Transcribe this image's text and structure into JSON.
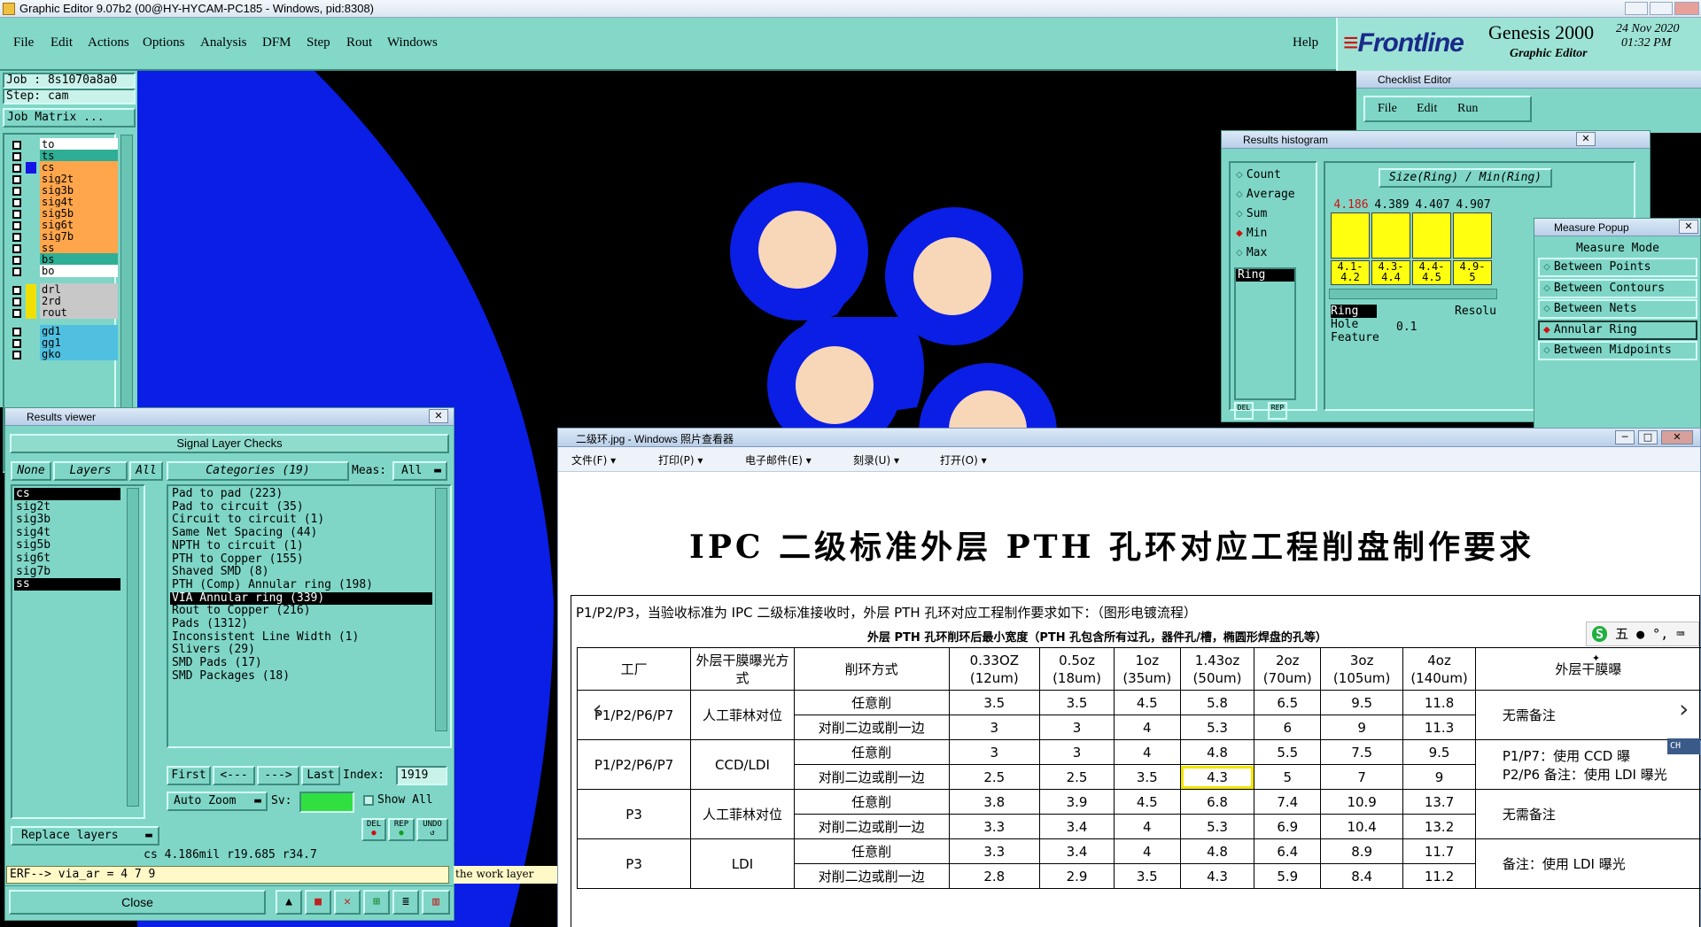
{
  "app": {
    "title": "Graphic Editor 9.07b2 (00@HY-HYCAM-PC185 - Windows, pid:8308)",
    "menu": [
      "File",
      "Edit",
      "Actions",
      "Options",
      "Analysis",
      "DFM",
      "Step",
      "Rout",
      "Windows"
    ],
    "help": "Help",
    "brand": "Frontline",
    "product": "Genesis 2000",
    "subtitle": "Graphic Editor",
    "date": "24 Nov 2020",
    "time": "01:32 PM"
  },
  "left": {
    "job": "Job : 8s1070a8a0",
    "step": "Step: cam",
    "matrix_btn": "Job Matrix ...",
    "layers": [
      {
        "name": "to",
        "bg": "#ffffff",
        "sel": false
      },
      {
        "name": "ts",
        "bg": "#2fae96",
        "sel": false
      },
      {
        "name": "cs",
        "bg": "#ffa64d",
        "sel": true
      },
      {
        "name": "sig2t",
        "bg": "#ffa64d",
        "sel": false
      },
      {
        "name": "sig3b",
        "bg": "#ffa64d",
        "sel": false
      },
      {
        "name": "sig4t",
        "bg": "#ffa64d",
        "sel": false
      },
      {
        "name": "sig5b",
        "bg": "#ffa64d",
        "sel": false
      },
      {
        "name": "sig6t",
        "bg": "#ffa64d",
        "sel": false
      },
      {
        "name": "sig7b",
        "bg": "#ffa64d",
        "sel": false
      },
      {
        "name": "ss",
        "bg": "#ffa64d",
        "sel": false
      },
      {
        "name": "bs",
        "bg": "#2fae96",
        "sel": false
      },
      {
        "name": "bo",
        "bg": "#ffffff",
        "sel": false
      },
      {
        "name": "drl",
        "bg": "#c8c8c8",
        "sel": false
      },
      {
        "name": "2rd",
        "bg": "#c8c8c8",
        "sel": false
      },
      {
        "name": "rout",
        "bg": "#c8c8c8",
        "sel": false
      },
      {
        "name": "gd1",
        "bg": "#4fc0e0",
        "sel": false
      },
      {
        "name": "gg1",
        "bg": "#4fc0e0",
        "sel": false
      },
      {
        "name": "gko",
        "bg": "#4fc0e0",
        "sel": false
      }
    ]
  },
  "results_viewer": {
    "title": "Results viewer",
    "header": "Signal Layer Checks",
    "none_btn": "None",
    "layers_btn": "Layers",
    "all_btn": "All",
    "categories_label": "Categories (19)",
    "meas_label": "Meas:",
    "meas_value": "All",
    "layers": [
      "cs",
      "sig2t",
      "sig3b",
      "sig4t",
      "sig5b",
      "sig6t",
      "sig7b",
      "ss"
    ],
    "categories": [
      "Pad to pad (223)",
      "Pad to circuit (35)",
      "Circuit to circuit (1)",
      "Same Net Spacing (44)",
      "NPTH to circuit (1)",
      "PTH to Copper (155)",
      "Shaved SMD (8)",
      "PTH (Comp) Annular ring (198)",
      "VIA Annular ring (339)",
      "Rout to Copper (216)",
      "Pads (1312)",
      "Inconsistent Line Width (1)",
      "Slivers (29)",
      "SMD Pads (17)",
      "SMD Packages (18)"
    ],
    "selected_category_index": 8,
    "first": "First",
    "prev": "<---",
    "next": "--->",
    "last": "Last",
    "index_label": "Index:",
    "index_value": "1919",
    "auto_zoom": "Auto Zoom",
    "sv_label": "Sv:",
    "show_all": "Show All",
    "replace_layers": "Replace layers",
    "status_line": "cs 4.186mil  r19.685  r34.7",
    "erf_line": "ERF--> via_ar = 4 7 9",
    "close": "Close",
    "del": "DEL",
    "rep": "REP",
    "undo": "UNDO",
    "work_layer_hint": "the work layer"
  },
  "checklist": {
    "title": "Checklist Editor",
    "menu": [
      "File",
      "Edit",
      "Run"
    ]
  },
  "histogram": {
    "title": "Results histogram",
    "options": [
      "Count",
      "Average",
      "Sum",
      "Min",
      "Max"
    ],
    "selected_option": "Min",
    "chart_title": "Size(Ring) / Min(Ring)",
    "list_item": "Ring",
    "bar_values": [
      "4.186",
      "4.389",
      "4.407",
      "4.907"
    ],
    "ranges": [
      "4.1-\n4.2",
      "4.3-\n4.4",
      "4.4-\n4.5",
      "4.9-\n5"
    ],
    "fields": [
      "Ring",
      "Hole",
      "Feature"
    ],
    "resolution_label": "Resolu",
    "resolution_value": "0.1",
    "del": "DEL",
    "rep": "REP"
  },
  "measure": {
    "title": "Measure Popup",
    "header": "Measure Mode",
    "options": [
      "Between Points",
      "Between Contours",
      "Between Nets",
      "Annular Ring",
      "Between Midpoints"
    ],
    "selected": "Annular Ring"
  },
  "image_viewer": {
    "title": "二级环.jpg - Windows 照片查看器",
    "menu": [
      "文件(F)",
      "打印(P)",
      "电子邮件(E)",
      "刻录(U)",
      "打开(O)"
    ],
    "doc_title": "IPC 二级标准外层 PTH 孔环对应工程削盘制作要求",
    "intro": "P1/P2/P3，当验收标准为 IPC 二级标准接收时，外层 PTH 孔环对应工程制作要求如下：（图形电镀流程）",
    "caption": "外层 PTH 孔环削环后最小宽度（PTH 孔包含所有过孔，器件孔/槽，椭圆形焊盘的孔等）",
    "headers": [
      "工厂",
      "外层干膜曝光方式",
      "削环方式",
      "0.33OZ\n(12um)",
      "0.5oz\n(18um)",
      "1oz\n(35um)",
      "1.43oz\n(50um)",
      "2oz\n(70um)",
      "3oz\n(105um)",
      "4oz\n(140um)",
      "外层干膜曝"
    ],
    "rows": [
      {
        "factory": "P1/P2/P6/P7",
        "exposure": "人工菲林对位",
        "mode": "任意削",
        "vals": [
          "3.5",
          "3.5",
          "4.5",
          "5.8",
          "6.5",
          "9.5",
          "11.8"
        ],
        "note": "无需备注"
      },
      {
        "factory": "",
        "exposure": "",
        "mode": "对削二边或削一边",
        "vals": [
          "3",
          "3",
          "4",
          "5.3",
          "6",
          "9",
          "11.3"
        ],
        "note": ""
      },
      {
        "factory": "P1/P2/P6/P7",
        "exposure": "CCD/LDI",
        "mode": "任意削",
        "vals": [
          "3",
          "3",
          "4",
          "4.8",
          "5.5",
          "7.5",
          "9.5"
        ],
        "note": "P1/P7：使用 CCD 曝"
      },
      {
        "factory": "",
        "exposure": "",
        "mode": "对削二边或削一边",
        "vals": [
          "2.5",
          "2.5",
          "3.5",
          "4.3",
          "5",
          "7",
          "9"
        ],
        "note": "P2/P6 备注：使用 LDI 曝光"
      },
      {
        "factory": "P3",
        "exposure": "人工菲林对位",
        "mode": "任意削",
        "vals": [
          "3.8",
          "3.9",
          "4.5",
          "6.8",
          "7.4",
          "10.9",
          "13.7"
        ],
        "note": "无需备注"
      },
      {
        "factory": "",
        "exposure": "",
        "mode": "对削二边或削一边",
        "vals": [
          "3.3",
          "3.4",
          "4",
          "5.3",
          "6.9",
          "10.4",
          "13.2"
        ],
        "note": ""
      },
      {
        "factory": "P3",
        "exposure": "LDI",
        "mode": "任意削",
        "vals": [
          "3.3",
          "3.4",
          "4",
          "4.8",
          "6.4",
          "8.9",
          "11.7"
        ],
        "note": "备注：使用 LDI 曝光"
      },
      {
        "factory": "",
        "exposure": "",
        "mode": "对削二边或削一边",
        "vals": [
          "2.8",
          "2.9",
          "3.5",
          "4.3",
          "5.9",
          "8.4",
          "11.2"
        ],
        "note": ""
      }
    ],
    "ime_text": "五",
    "ch_label": "CH"
  },
  "colors": {
    "panel": "#7fd6c6",
    "canvas": "#000000",
    "copper": "#0a1ee6",
    "drill": "#f8d6b8",
    "highlight": "#f2e600"
  }
}
